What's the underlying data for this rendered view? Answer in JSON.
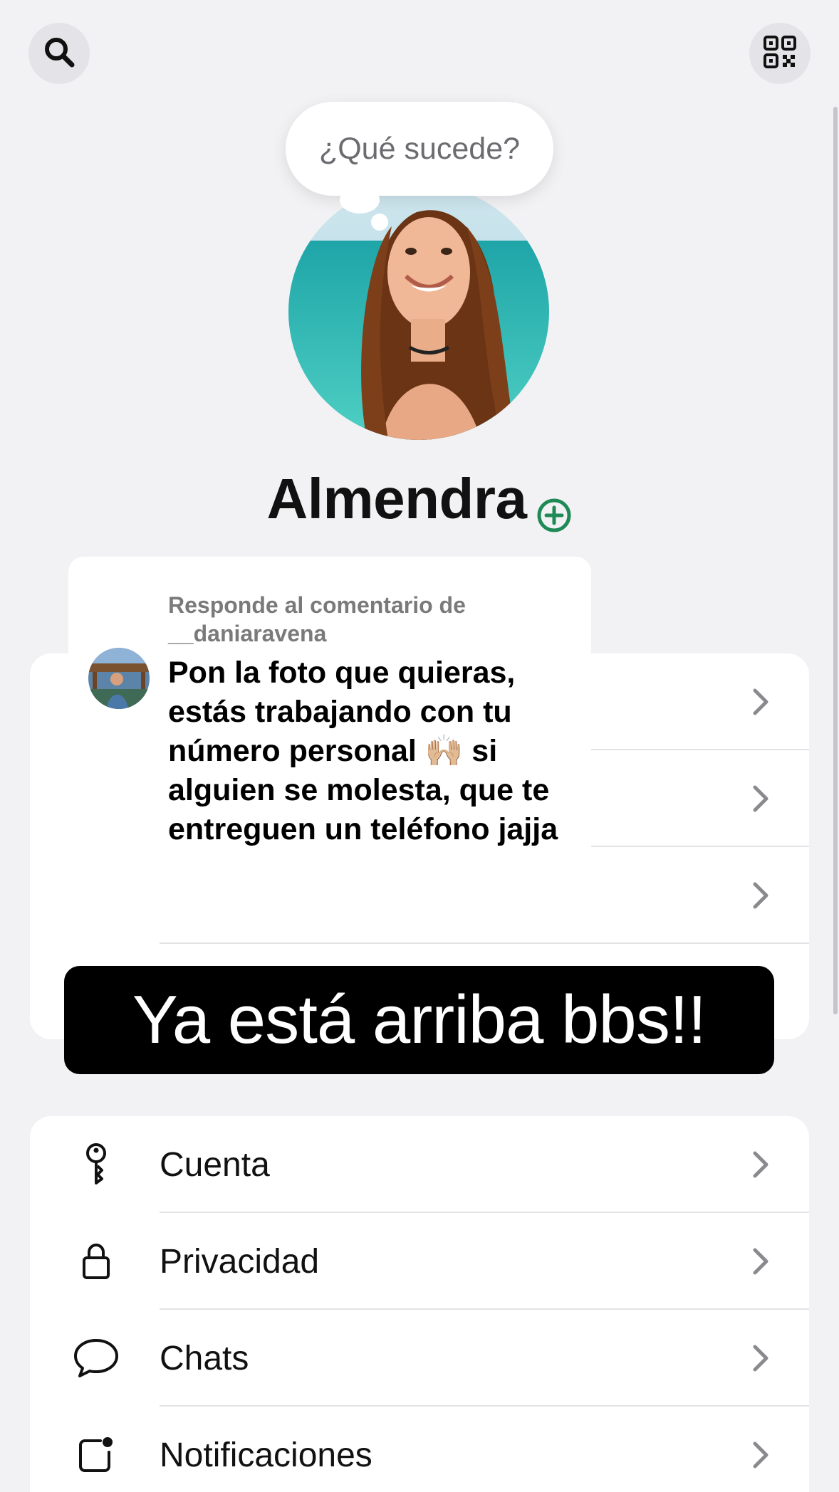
{
  "header": {
    "search_icon": "search-icon",
    "qr_icon": "qr-code-icon"
  },
  "status_bubble": {
    "text": "¿Qué sucede?"
  },
  "profile": {
    "name": "Almendra",
    "add_status_icon": "plus-circle-icon",
    "accent_color": "#1f8a55"
  },
  "overlay_comment": {
    "header": "Responde al comentario de __daniaravena",
    "body": "Pon la foto que quieras, estás trabajando con tu número personal 🙌🏼 si alguien se molesta, que te entreguen un teléfono jajja"
  },
  "caption": {
    "text": "Ya está arriba bbs!!"
  },
  "settings_top": {
    "rows": [
      {
        "chevron": "chevron-right-icon"
      },
      {
        "chevron": "chevron-right-icon"
      },
      {
        "chevron": "chevron-right-icon"
      }
    ]
  },
  "settings": {
    "items": [
      {
        "label": "Cuenta",
        "icon": "key-icon"
      },
      {
        "label": "Privacidad",
        "icon": "lock-icon"
      },
      {
        "label": "Chats",
        "icon": "chat-bubble-icon"
      },
      {
        "label": "Notificaciones",
        "icon": "notification-badge-icon"
      }
    ]
  }
}
